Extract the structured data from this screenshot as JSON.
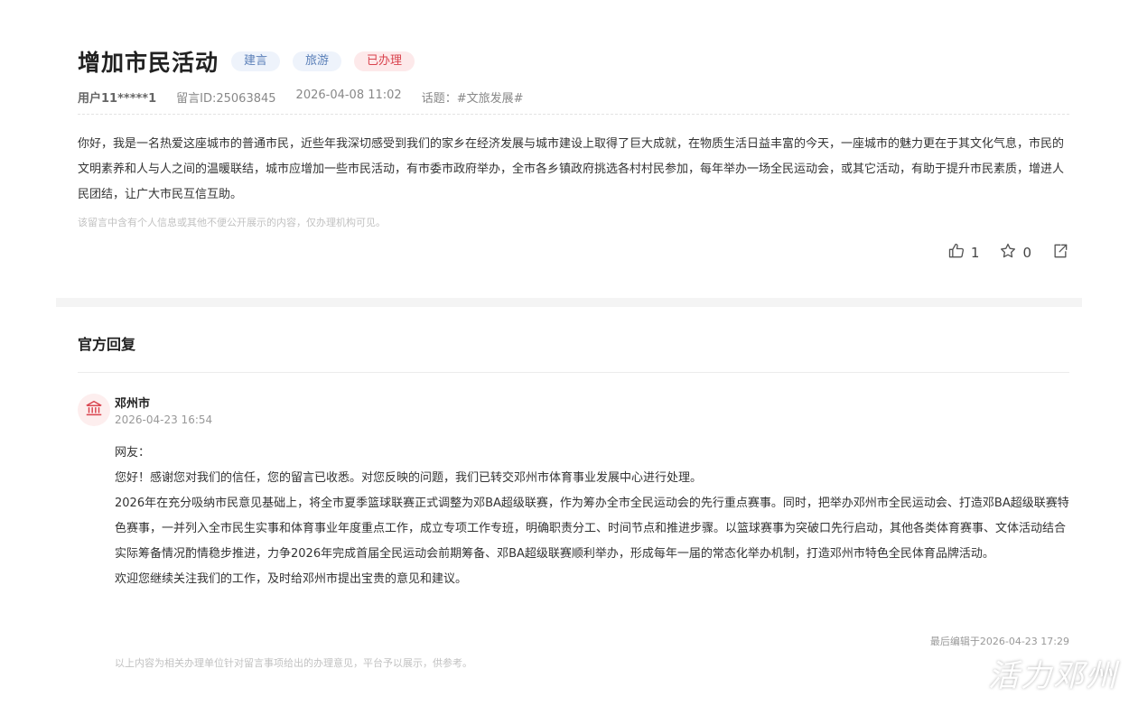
{
  "post": {
    "title": "增加市民活动",
    "tags": [
      "建言",
      "旅游",
      "已办理"
    ],
    "user": "用户11*****1",
    "message_id": "留言ID:25063845",
    "datetime": "2026-04-08 11:02",
    "topic": "话题：#文旅发展#",
    "content": "你好，我是一名热爱这座城市的普通市民，近些年我深切感受到我们的家乡在经济发展与城市建设上取得了巨大成就，在物质生活日益丰富的今天，一座城市的魅力更在于其文化气息，市民的文明素养和人与人之间的温暖联结，城市应增加一些市民活动，有市委市政府举办，全市各乡镇政府挑选各村村民参加，每年举办一场全民运动会，或其它活动，有助于提升市民素质，增进人民团结，让广大市民互信互助。",
    "privacy_note": "该留言中含有个人信息或其他不便公开展示的内容，仅办理机构可见。",
    "likes": "1",
    "favorites": "0"
  },
  "reply": {
    "heading": "官方回复",
    "org": "邓州市",
    "date": "2026-04-23 16:54",
    "paragraphs": [
      "网友：",
      "您好！感谢您对我们的信任，您的留言已收悉。对您反映的问题，我们已转交邓州市体育事业发展中心进行处理。",
      "2026年在充分吸纳市民意见基础上，将全市夏季篮球联赛正式调整为邓BA超级联赛，作为筹办全市全民运动会的先行重点赛事。同时，把举办邓州市全民运动会、打造邓BA超级联赛特色赛事，一并列入全市民生实事和体育事业年度重点工作，成立专项工作专班，明确职责分工、时间节点和推进步骤。以篮球赛事为突破口先行启动，其他各类体育赛事、文体活动结合实际筹备情况酌情稳步推进，力争2026年完成首届全民运动会前期筹备、邓BA超级联赛顺利举办，形成每年一届的常态化举办机制，打造邓州市特色全民体育品牌活动。",
      "欢迎您继续关注我们的工作，及时给邓州市提出宝贵的意见和建议。"
    ],
    "last_edit": "最后编辑于2026-04-23 17:29",
    "disclaimer": "以上内容为相关办理单位针对留言事项给出的办理意见，平台予以展示，供参考。"
  },
  "watermark": "活力邓州",
  "icons": {
    "like": "thumbs-up-icon",
    "favorite": "star-icon",
    "share": "share-icon",
    "org": "government-building-icon"
  },
  "colors": {
    "tag_blue_bg": "#eef3fb",
    "tag_blue_text": "#5a7fb8",
    "tag_red_bg": "#fde9ea",
    "tag_red_text": "#d9434e",
    "org_icon": "#d9434e"
  }
}
